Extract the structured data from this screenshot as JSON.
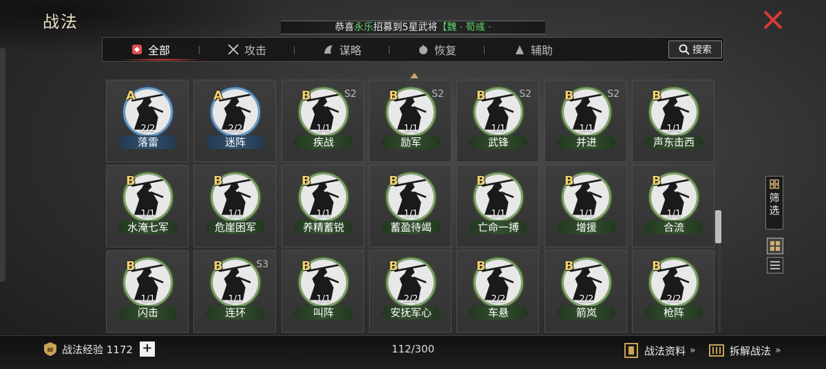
{
  "header": {
    "title": "战法",
    "banner": {
      "prefix": "恭喜",
      "player": "永乐",
      "middle": "招募到5星武将",
      "general": "【魏 · 荀彧 ·"
    }
  },
  "tabs": [
    {
      "label": "全部",
      "icon": "all-icon",
      "active": true
    },
    {
      "label": "攻击",
      "icon": "crossed-swords-icon",
      "active": false
    },
    {
      "label": "谋略",
      "icon": "scroll-icon",
      "active": false
    },
    {
      "label": "恢复",
      "icon": "recover-icon",
      "active": false
    },
    {
      "label": "辅助",
      "icon": "support-icon",
      "active": false
    }
  ],
  "search": {
    "label": "搜索"
  },
  "tactics": [
    {
      "name": "落雷",
      "grade": "A",
      "count": "2/2",
      "season": ""
    },
    {
      "name": "迷阵",
      "grade": "A",
      "count": "2/2",
      "season": ""
    },
    {
      "name": "疾战",
      "grade": "B",
      "count": "1/1",
      "season": "S2"
    },
    {
      "name": "励军",
      "grade": "B",
      "count": "1/1",
      "season": "S2"
    },
    {
      "name": "武锋",
      "grade": "B",
      "count": "1/1",
      "season": "S2"
    },
    {
      "name": "并进",
      "grade": "B",
      "count": "1/1",
      "season": "S2"
    },
    {
      "name": "声东击西",
      "grade": "B",
      "count": "1/1",
      "season": ""
    },
    {
      "name": "水淹七军",
      "grade": "B",
      "count": "1/1",
      "season": ""
    },
    {
      "name": "危崖困军",
      "grade": "B",
      "count": "1/1",
      "season": ""
    },
    {
      "name": "养精蓄锐",
      "grade": "B",
      "count": "1/1",
      "season": ""
    },
    {
      "name": "蓄盈待竭",
      "grade": "B",
      "count": "1/1",
      "season": ""
    },
    {
      "name": "亡命一搏",
      "grade": "B",
      "count": "1/1",
      "season": ""
    },
    {
      "name": "增援",
      "grade": "B",
      "count": "1/1",
      "season": ""
    },
    {
      "name": "合流",
      "grade": "B",
      "count": "1/1",
      "season": ""
    },
    {
      "name": "闪击",
      "grade": "B",
      "count": "1/1",
      "season": ""
    },
    {
      "name": "连环",
      "grade": "B",
      "count": "1/1",
      "season": "S3"
    },
    {
      "name": "叫阵",
      "grade": "B",
      "count": "1/1",
      "season": ""
    },
    {
      "name": "安抚军心",
      "grade": "B",
      "count": "2/2",
      "season": ""
    },
    {
      "name": "车悬",
      "grade": "B",
      "count": "2/2",
      "season": ""
    },
    {
      "name": "箭岚",
      "grade": "B",
      "count": "2/2",
      "season": ""
    },
    {
      "name": "枪阵",
      "grade": "B",
      "count": "2/2",
      "season": ""
    }
  ],
  "side": {
    "filter_label": "筛选"
  },
  "footer": {
    "exp_label": "战法经验 1172",
    "capacity": "112/300",
    "info_label": "战法资料",
    "disassemble_label": "拆解战法",
    "arrow": "»"
  },
  "colors": {
    "accent_red": "#d83a3a",
    "highlight_green": "#5fd36a",
    "grade_gold": "#f0d070",
    "grade_a_ring": "#6d9bc7",
    "grade_b_ring": "#7fa36a"
  }
}
